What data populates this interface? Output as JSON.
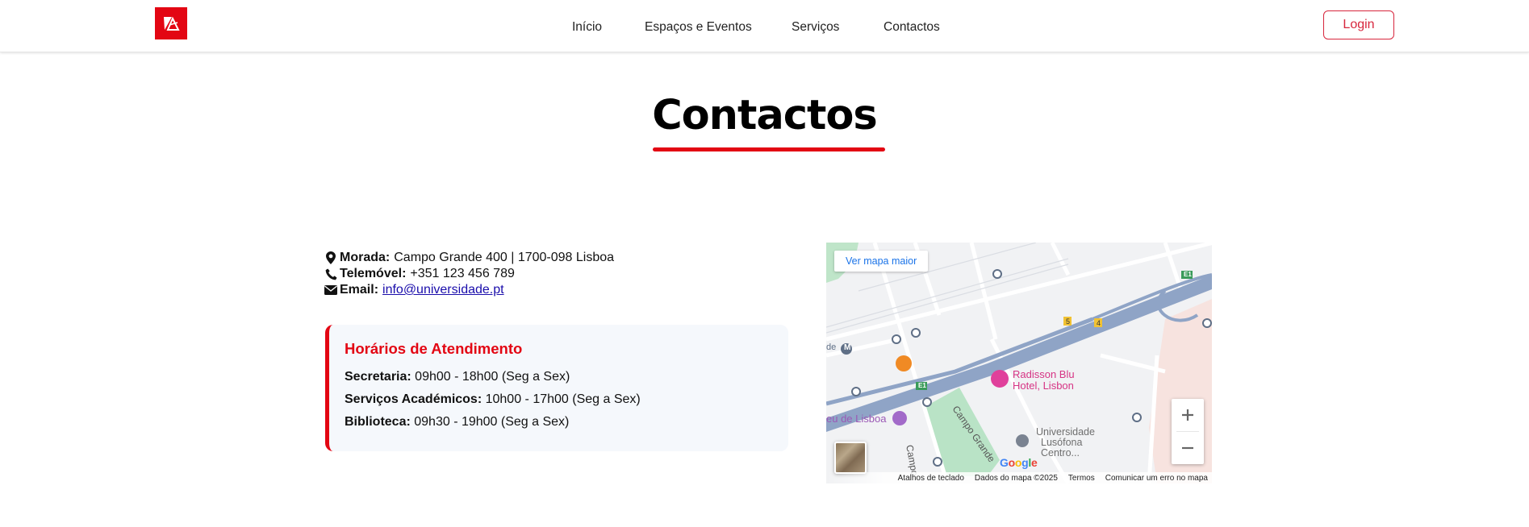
{
  "navbar": {
    "links": [
      "Início",
      "Espaços e Eventos",
      "Serviços",
      "Contactos"
    ],
    "login_label": "Login"
  },
  "page": {
    "title": "Contactos"
  },
  "contact": {
    "address_label": "Morada:",
    "address_value": "Campo Grande 400 | 1700-098 Lisboa",
    "phone_label": "Telemóvel:",
    "phone_value": "+351 123 456 789",
    "email_label": "Email:",
    "email_value": "info@universidade.pt"
  },
  "hours": {
    "title": "Horários de Atendimento",
    "rows": [
      {
        "label": "Secretaria:",
        "value": "09h00 - 18h00 (Seg a Sex)"
      },
      {
        "label": "Serviços Académicos:",
        "value": "10h00 - 17h00 (Seg a Sex)"
      },
      {
        "label": "Biblioteca:",
        "value": "09h30 - 19h00 (Seg a Sex)"
      }
    ]
  },
  "map": {
    "view_larger": "Ver mapa maior",
    "labels": {
      "hotel": "Radisson Blu\nHotel, Lisbon",
      "hotel_line1": "Radisson Blu",
      "hotel_line2": "Hotel, Lisbon",
      "museum": "eu de Lisboa",
      "street": "Campo Grande",
      "street2": "Campo",
      "university_line1": "Universidade",
      "university_line2": "Lusófona",
      "university_line3": "Centro...",
      "metro": "M",
      "metro_prefix": "de",
      "road_e1": "E1",
      "exit_5": "5",
      "exit_4": "4",
      "google": "Google"
    },
    "footer": [
      "Atalhos de teclado",
      "Dados do mapa ©2025",
      "Termos",
      "Comunicar um erro no mapa"
    ]
  },
  "colors": {
    "brand_red": "#e30613",
    "login_red": "#d7263d",
    "card_bg": "#f5f8fc",
    "link_blue": "#1a0dab",
    "highway": "#8fa4c6",
    "park": "#b9e3c6",
    "hotel_pink": "#e0409b"
  },
  "icons": {
    "logo": "brand-logo-icon",
    "address": "map-marker-icon",
    "phone": "phone-icon",
    "email": "envelope-icon"
  }
}
